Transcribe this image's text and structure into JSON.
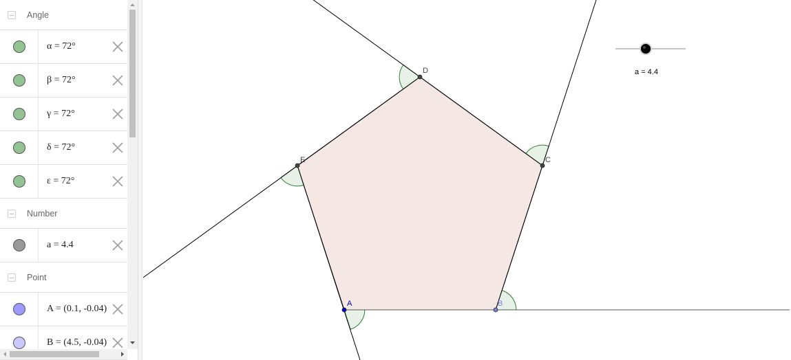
{
  "algebra": {
    "groups": [
      {
        "label": "Angle",
        "items": [
          {
            "text": "α = 72°",
            "color": "#93c393"
          },
          {
            "text": "β = 72°",
            "color": "#93c393"
          },
          {
            "text": "γ = 72°",
            "color": "#93c393"
          },
          {
            "text": "δ = 72°",
            "color": "#93c393"
          },
          {
            "text": "ε = 72°",
            "color": "#93c393"
          }
        ]
      },
      {
        "label": "Number",
        "items": [
          {
            "text": "a = 4.4",
            "color": "#9a9a9a"
          }
        ]
      },
      {
        "label": "Point",
        "items": [
          {
            "text": "A = (0.1, -0.04)",
            "color": "#9a9aff"
          },
          {
            "text": "B = (4.5, -0.04)",
            "color": "#c9c9ff"
          }
        ]
      }
    ]
  },
  "graphics": {
    "slider_label": "a = 4.4",
    "points": [
      {
        "name": "A",
        "color": "#0000cc"
      },
      {
        "name": "B",
        "color": "#8080e0"
      },
      {
        "name": "C",
        "color": "#444444"
      },
      {
        "name": "D",
        "color": "#444444"
      },
      {
        "name": "E",
        "color": "#444444"
      }
    ],
    "polygon_fill": "#f5e8e4",
    "angle_fill": "#e7f1e7",
    "angle_stroke": "#2e7d32"
  }
}
